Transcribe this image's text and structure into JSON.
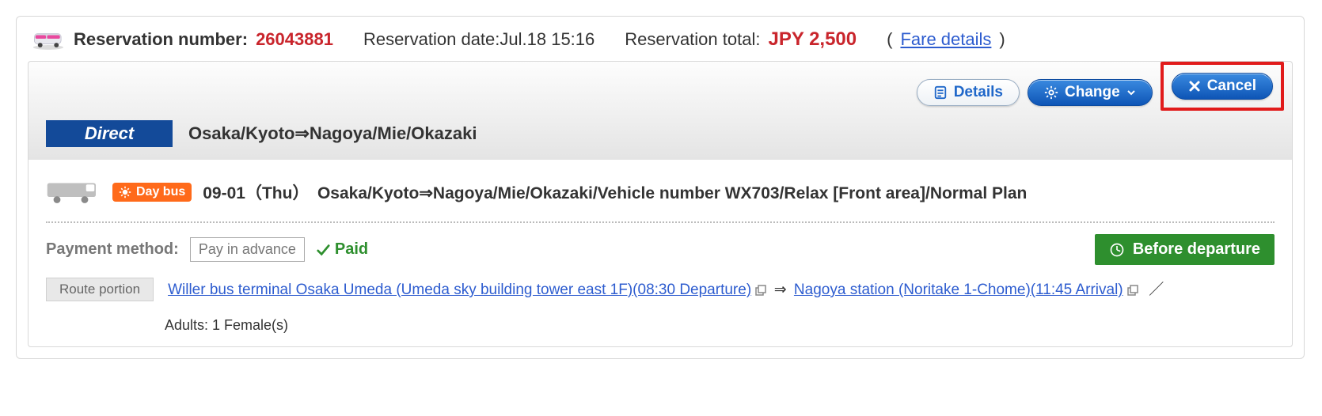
{
  "header": {
    "res_num_label": "Reservation number:",
    "res_num_value": "26043881",
    "res_date_combined": "Reservation date:Jul.18 15:16",
    "res_total_label": "Reservation total:",
    "res_total_value": "JPY 2,500",
    "fare_details": "Fare details"
  },
  "toolbar": {
    "details": "Details",
    "change": "Change",
    "cancel": "Cancel",
    "direct_badge": "Direct",
    "route_title": "Osaka/Kyoto⇒Nagoya/Mie/Okazaki"
  },
  "trip": {
    "daybus": "Day bus",
    "line": "09-01（Thu）　Osaka/Kyoto⇒Nagoya/Mie/Okazaki/Vehicle number WX703/Relax [Front area]/Normal Plan"
  },
  "payment": {
    "label": "Payment method:",
    "method": "Pay in advance",
    "status": "Paid",
    "before_departure": "Before departure"
  },
  "route": {
    "portion_label": "Route portion",
    "dep_link": "Willer bus terminal Osaka Umeda (Umeda sky building tower east 1F)(08:30 Departure)",
    "arrow": "⇒",
    "arr_link": "Nagoya station (Noritake 1-Chome)(11:45 Arrival)",
    "slash": "／",
    "pax": "Adults: 1 Female(s)"
  }
}
